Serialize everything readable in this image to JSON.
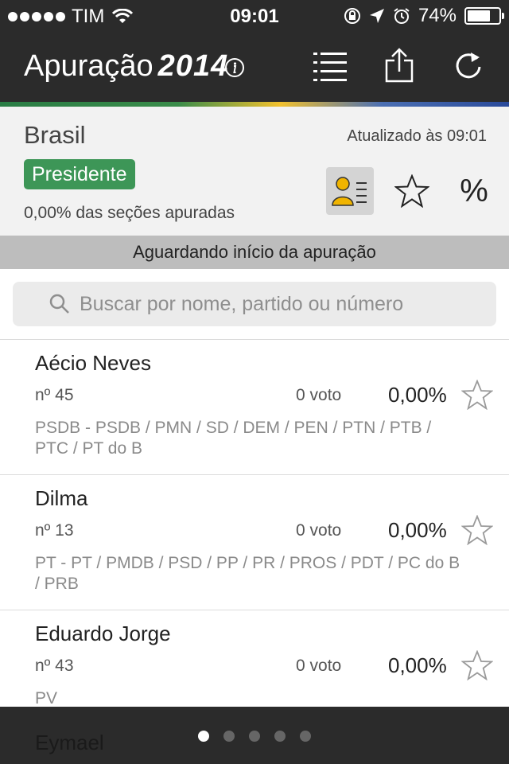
{
  "status": {
    "carrier": "TIM",
    "time": "09:01",
    "battery": "74%",
    "battery_level": 0.74
  },
  "nav": {
    "title": "Apuração",
    "year": "2014",
    "icons": [
      "info-icon",
      "list-icon",
      "share-icon",
      "refresh-icon"
    ]
  },
  "header": {
    "region": "Brasil",
    "updated": "Atualizado às 09:01",
    "office": "Presidente",
    "sections": "0,00% das seções apuradas",
    "percent_symbol": "%"
  },
  "banner": "Aguardando início da apuração",
  "search": {
    "placeholder": "Buscar por nome, partido ou número"
  },
  "candidates": [
    {
      "name": "Aécio Neves",
      "number": "nº 45",
      "votes": "0 voto",
      "percent": "0,00%",
      "parties": "PSDB - PSDB / PMN / SD / DEM / PEN / PTN / PTB / PTC / PT do B"
    },
    {
      "name": "Dilma",
      "number": "nº 13",
      "votes": "0 voto",
      "percent": "0,00%",
      "parties": "PT - PT / PMDB / PSD / PP / PR / PROS / PDT / PC do B / PRB"
    },
    {
      "name": "Eduardo Jorge",
      "number": "nº 43",
      "votes": "0 voto",
      "percent": "0,00%",
      "parties": "PV"
    }
  ],
  "peek_name": "Eymael",
  "pager": {
    "pages": 5,
    "current": 1
  },
  "colors": {
    "bar": "#2b2b2b",
    "badge": "#3d9657",
    "active_tool": "#f0b400"
  }
}
